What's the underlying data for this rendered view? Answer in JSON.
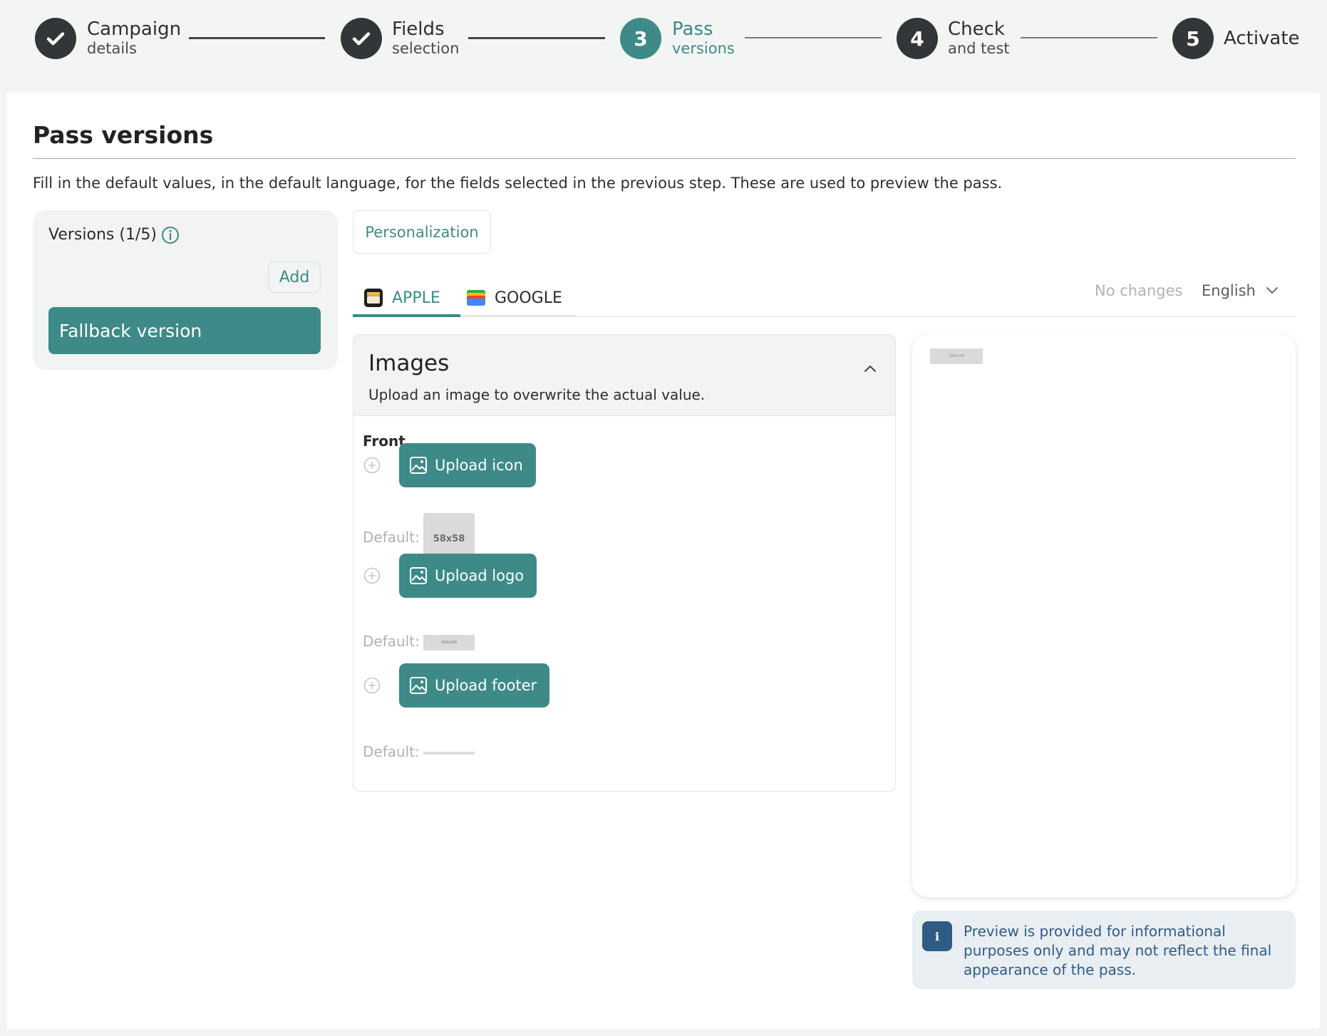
{
  "stepper": {
    "steps": [
      {
        "number": "1",
        "title": "Campaign",
        "subtitle": "details",
        "status": "completed"
      },
      {
        "number": "2",
        "title": "Fields",
        "subtitle": "selection",
        "status": "completed"
      },
      {
        "number": "3",
        "title": "Pass",
        "subtitle": "versions",
        "status": "active"
      },
      {
        "number": "4",
        "title": "Check",
        "subtitle": "and test",
        "status": "upcoming"
      },
      {
        "number": "5",
        "title": "Activate",
        "subtitle": "",
        "status": "upcoming"
      }
    ]
  },
  "page": {
    "title": "Pass versions",
    "intro": "Fill in the default values, in the default language, for the fields selected in the previous step. These are used to preview the pass."
  },
  "versions": {
    "title": "Versions (1/5)",
    "info_icon": "info-icon",
    "add_label": "Add",
    "items": [
      "Fallback version"
    ]
  },
  "tabs": {
    "personalization": "Personalization",
    "platforms": [
      {
        "label": "APPLE",
        "icon": "apple-wallet-icon",
        "active": true
      },
      {
        "label": "GOOGLE",
        "icon": "google-wallet-icon",
        "active": false
      }
    ],
    "status": "No changes",
    "language": "English"
  },
  "images": {
    "title": "Images",
    "subtitle": "Upload an image to overwrite the actual value.",
    "section_label": "Front",
    "uploads": [
      {
        "button": "Upload icon",
        "default_label": "Default:",
        "thumb_text": "58x58"
      },
      {
        "button": "Upload logo",
        "default_label": "Default:",
        "thumb_text": "320x100"
      },
      {
        "button": "Upload footer",
        "default_label": "Default:",
        "thumb_text": ""
      }
    ]
  },
  "preview": {
    "chip_text": "320x100",
    "notice_icon": "i",
    "notice": "Preview is provided for informational purposes only and may not reflect the final appearance of the pass."
  },
  "colors": {
    "accent": "#3d8a88",
    "dark": "#333638",
    "notice_bg": "#e9eef3",
    "notice_text": "#2f5c86"
  }
}
